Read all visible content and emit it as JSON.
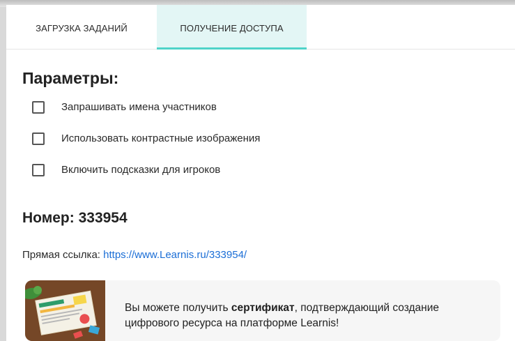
{
  "tabs": [
    {
      "label": "ЗАГРУЗКА ЗАДАНИЙ"
    },
    {
      "label": "ПОЛУЧЕНИЕ ДОСТУПА"
    }
  ],
  "params": {
    "title": "Параметры:",
    "options": [
      {
        "label": "Запрашивать имена участников",
        "checked": false
      },
      {
        "label": "Использовать контрастные изображения",
        "checked": false
      },
      {
        "label": "Включить подсказки для игроков",
        "checked": false
      }
    ]
  },
  "number": {
    "title": "Номер: 333954"
  },
  "direct_link": {
    "label": "Прямая ссылка:",
    "url": "https://www.Learnis.ru/333954/"
  },
  "certificate": {
    "text_before": "Вы можете получить ",
    "text_bold": "сертификат",
    "text_after": ", подтверждающий создание цифрового ресурса на платформе Learnis!"
  },
  "colors": {
    "active_tab_bg": "#e3f6f5",
    "active_tab_indicator": "#4fd3c9",
    "link": "#1b6ed6"
  }
}
